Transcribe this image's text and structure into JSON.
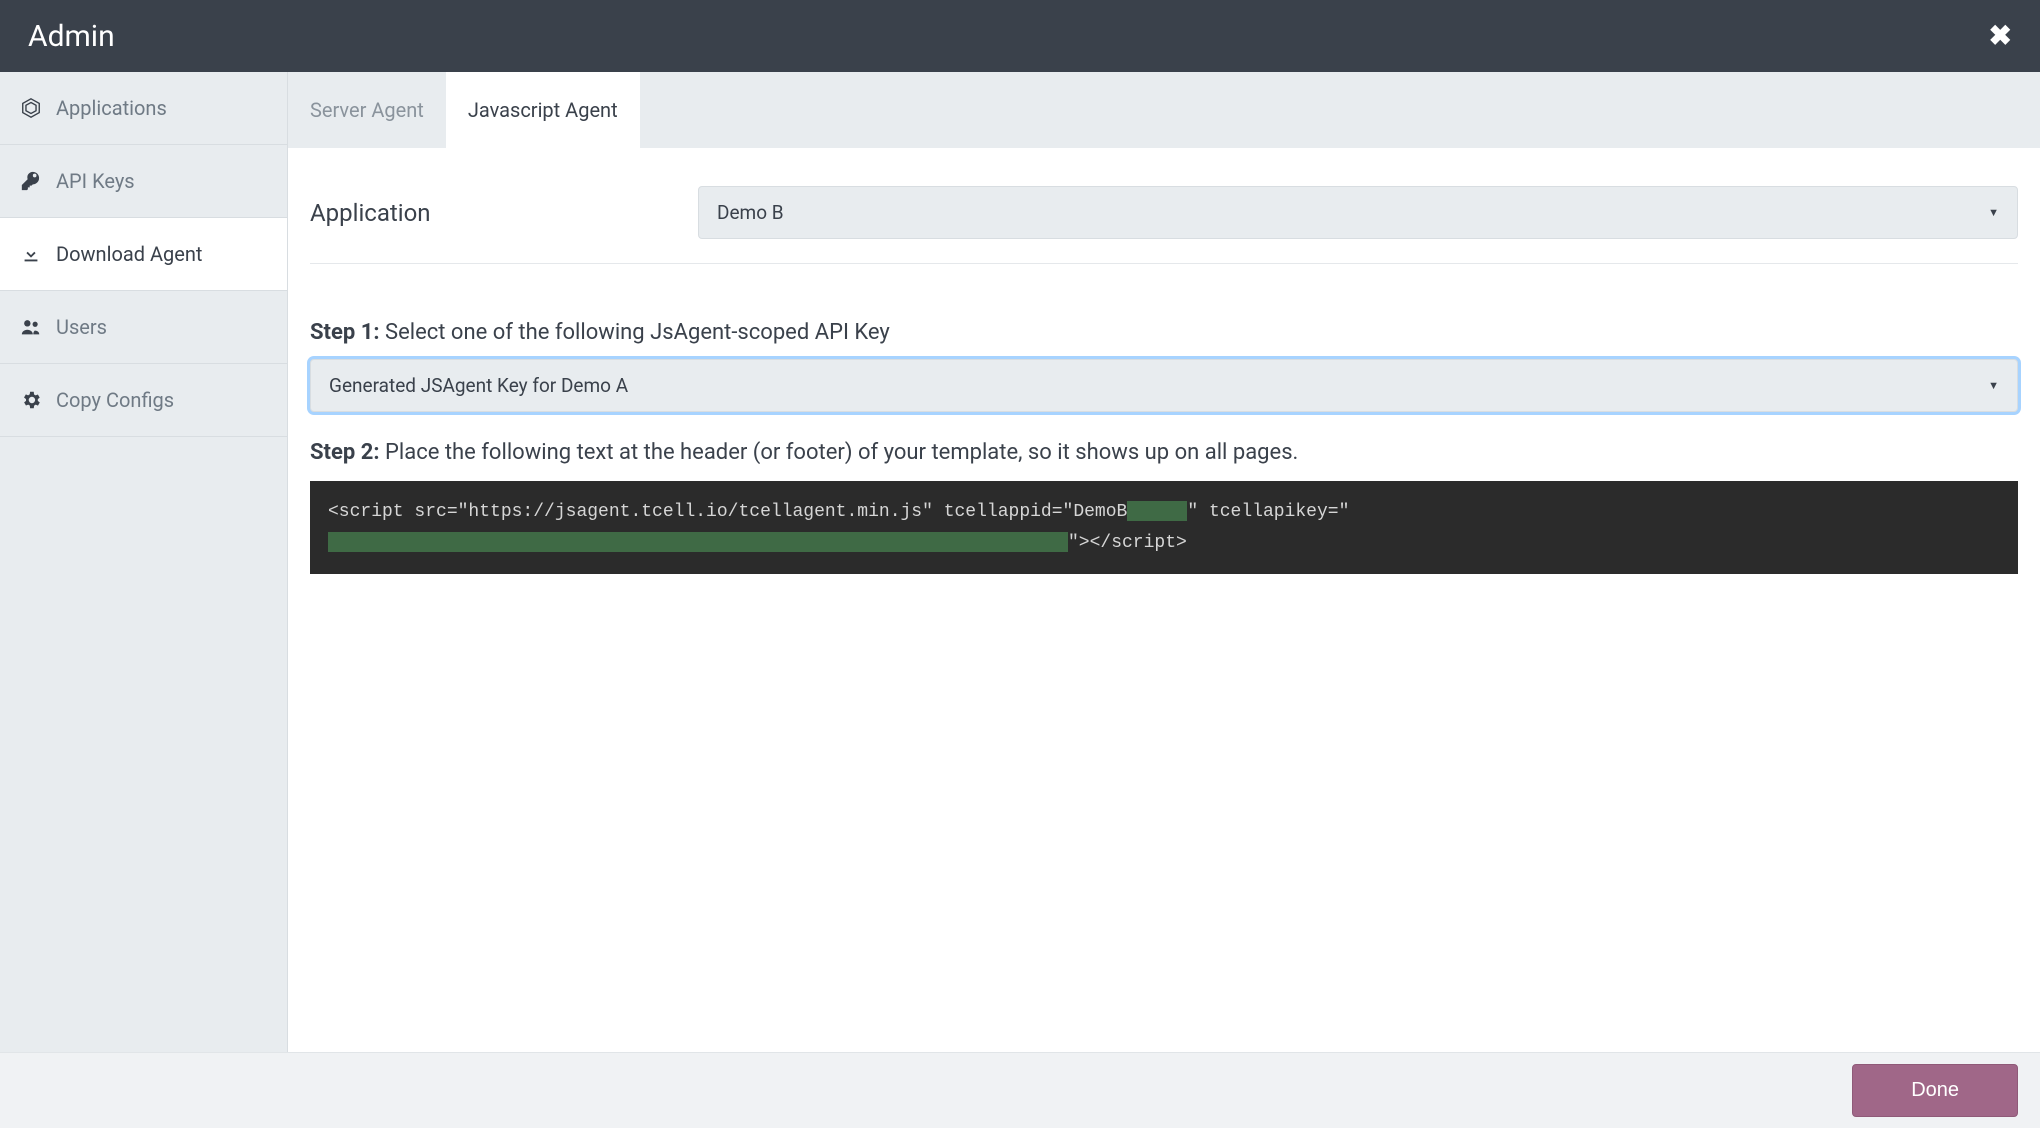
{
  "header": {
    "title": "Admin"
  },
  "sidebar": {
    "items": [
      {
        "label": "Applications"
      },
      {
        "label": "API Keys"
      },
      {
        "label": "Download Agent"
      },
      {
        "label": "Users"
      },
      {
        "label": "Copy Configs"
      }
    ]
  },
  "tabs": {
    "server": "Server Agent",
    "javascript": "Javascript Agent"
  },
  "application": {
    "label": "Application",
    "selected": "Demo B"
  },
  "step1": {
    "label": "Step 1:",
    "text": "Select one of the following JsAgent-scoped API Key",
    "selected": "Generated JSAgent Key for Demo A"
  },
  "step2": {
    "label": "Step 2:",
    "text": "Place the following text at the header (or footer) of your template, so it shows up on all pages.",
    "code": {
      "prefix": "<script src=\"https://jsagent.tcell.io/tcellagent.min.js\" tcellappid=\"DemoB",
      "mid": "\" tcellapikey=\"",
      "suffix": "\"></script>"
    }
  },
  "footer": {
    "done": "Done"
  }
}
